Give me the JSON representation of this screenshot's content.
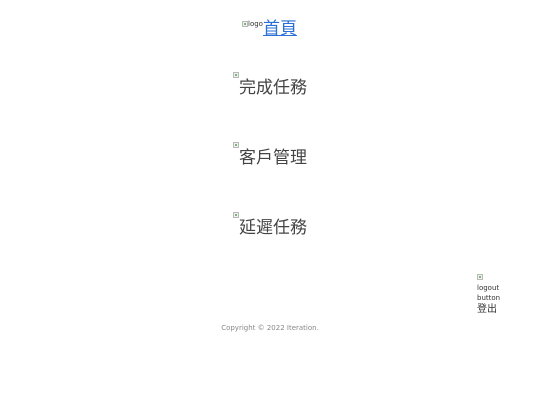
{
  "header": {
    "logo_alt": "logo",
    "home_label": "首頁"
  },
  "nav": {
    "items": [
      {
        "label": "完成任務"
      },
      {
        "label": "客戶管理"
      },
      {
        "label": "延遲任務"
      }
    ]
  },
  "logout": {
    "alt_line1": "logout",
    "alt_line2": "button",
    "label": "登出"
  },
  "footer": {
    "copyright": "Copyright © 2022 Iteration."
  }
}
